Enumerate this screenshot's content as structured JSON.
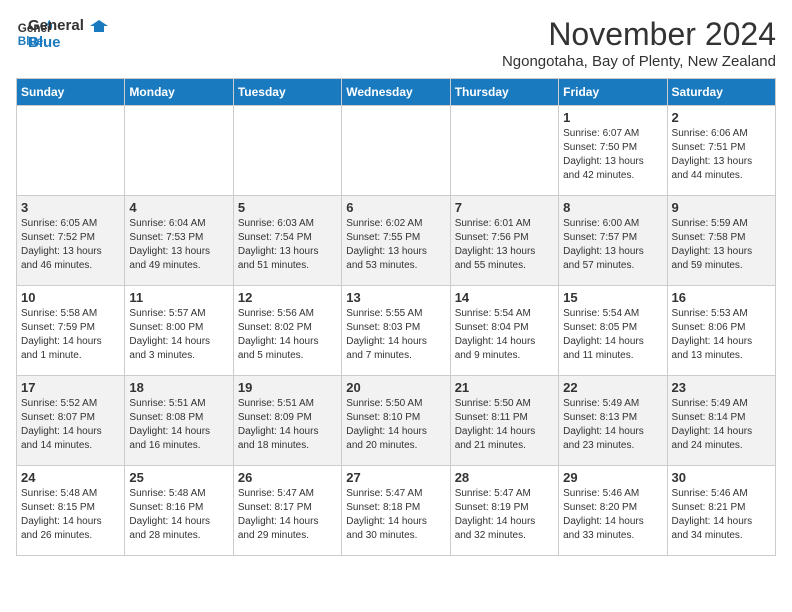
{
  "header": {
    "logo_line1": "General",
    "logo_line2": "Blue",
    "month": "November 2024",
    "location": "Ngongotaha, Bay of Plenty, New Zealand"
  },
  "weekdays": [
    "Sunday",
    "Monday",
    "Tuesday",
    "Wednesday",
    "Thursday",
    "Friday",
    "Saturday"
  ],
  "weeks": [
    [
      {
        "day": "",
        "info": ""
      },
      {
        "day": "",
        "info": ""
      },
      {
        "day": "",
        "info": ""
      },
      {
        "day": "",
        "info": ""
      },
      {
        "day": "",
        "info": ""
      },
      {
        "day": "1",
        "info": "Sunrise: 6:07 AM\nSunset: 7:50 PM\nDaylight: 13 hours\nand 42 minutes."
      },
      {
        "day": "2",
        "info": "Sunrise: 6:06 AM\nSunset: 7:51 PM\nDaylight: 13 hours\nand 44 minutes."
      }
    ],
    [
      {
        "day": "3",
        "info": "Sunrise: 6:05 AM\nSunset: 7:52 PM\nDaylight: 13 hours\nand 46 minutes."
      },
      {
        "day": "4",
        "info": "Sunrise: 6:04 AM\nSunset: 7:53 PM\nDaylight: 13 hours\nand 49 minutes."
      },
      {
        "day": "5",
        "info": "Sunrise: 6:03 AM\nSunset: 7:54 PM\nDaylight: 13 hours\nand 51 minutes."
      },
      {
        "day": "6",
        "info": "Sunrise: 6:02 AM\nSunset: 7:55 PM\nDaylight: 13 hours\nand 53 minutes."
      },
      {
        "day": "7",
        "info": "Sunrise: 6:01 AM\nSunset: 7:56 PM\nDaylight: 13 hours\nand 55 minutes."
      },
      {
        "day": "8",
        "info": "Sunrise: 6:00 AM\nSunset: 7:57 PM\nDaylight: 13 hours\nand 57 minutes."
      },
      {
        "day": "9",
        "info": "Sunrise: 5:59 AM\nSunset: 7:58 PM\nDaylight: 13 hours\nand 59 minutes."
      }
    ],
    [
      {
        "day": "10",
        "info": "Sunrise: 5:58 AM\nSunset: 7:59 PM\nDaylight: 14 hours\nand 1 minute."
      },
      {
        "day": "11",
        "info": "Sunrise: 5:57 AM\nSunset: 8:00 PM\nDaylight: 14 hours\nand 3 minutes."
      },
      {
        "day": "12",
        "info": "Sunrise: 5:56 AM\nSunset: 8:02 PM\nDaylight: 14 hours\nand 5 minutes."
      },
      {
        "day": "13",
        "info": "Sunrise: 5:55 AM\nSunset: 8:03 PM\nDaylight: 14 hours\nand 7 minutes."
      },
      {
        "day": "14",
        "info": "Sunrise: 5:54 AM\nSunset: 8:04 PM\nDaylight: 14 hours\nand 9 minutes."
      },
      {
        "day": "15",
        "info": "Sunrise: 5:54 AM\nSunset: 8:05 PM\nDaylight: 14 hours\nand 11 minutes."
      },
      {
        "day": "16",
        "info": "Sunrise: 5:53 AM\nSunset: 8:06 PM\nDaylight: 14 hours\nand 13 minutes."
      }
    ],
    [
      {
        "day": "17",
        "info": "Sunrise: 5:52 AM\nSunset: 8:07 PM\nDaylight: 14 hours\nand 14 minutes."
      },
      {
        "day": "18",
        "info": "Sunrise: 5:51 AM\nSunset: 8:08 PM\nDaylight: 14 hours\nand 16 minutes."
      },
      {
        "day": "19",
        "info": "Sunrise: 5:51 AM\nSunset: 8:09 PM\nDaylight: 14 hours\nand 18 minutes."
      },
      {
        "day": "20",
        "info": "Sunrise: 5:50 AM\nSunset: 8:10 PM\nDaylight: 14 hours\nand 20 minutes."
      },
      {
        "day": "21",
        "info": "Sunrise: 5:50 AM\nSunset: 8:11 PM\nDaylight: 14 hours\nand 21 minutes."
      },
      {
        "day": "22",
        "info": "Sunrise: 5:49 AM\nSunset: 8:13 PM\nDaylight: 14 hours\nand 23 minutes."
      },
      {
        "day": "23",
        "info": "Sunrise: 5:49 AM\nSunset: 8:14 PM\nDaylight: 14 hours\nand 24 minutes."
      }
    ],
    [
      {
        "day": "24",
        "info": "Sunrise: 5:48 AM\nSunset: 8:15 PM\nDaylight: 14 hours\nand 26 minutes."
      },
      {
        "day": "25",
        "info": "Sunrise: 5:48 AM\nSunset: 8:16 PM\nDaylight: 14 hours\nand 28 minutes."
      },
      {
        "day": "26",
        "info": "Sunrise: 5:47 AM\nSunset: 8:17 PM\nDaylight: 14 hours\nand 29 minutes."
      },
      {
        "day": "27",
        "info": "Sunrise: 5:47 AM\nSunset: 8:18 PM\nDaylight: 14 hours\nand 30 minutes."
      },
      {
        "day": "28",
        "info": "Sunrise: 5:47 AM\nSunset: 8:19 PM\nDaylight: 14 hours\nand 32 minutes."
      },
      {
        "day": "29",
        "info": "Sunrise: 5:46 AM\nSunset: 8:20 PM\nDaylight: 14 hours\nand 33 minutes."
      },
      {
        "day": "30",
        "info": "Sunrise: 5:46 AM\nSunset: 8:21 PM\nDaylight: 14 hours\nand 34 minutes."
      }
    ]
  ]
}
